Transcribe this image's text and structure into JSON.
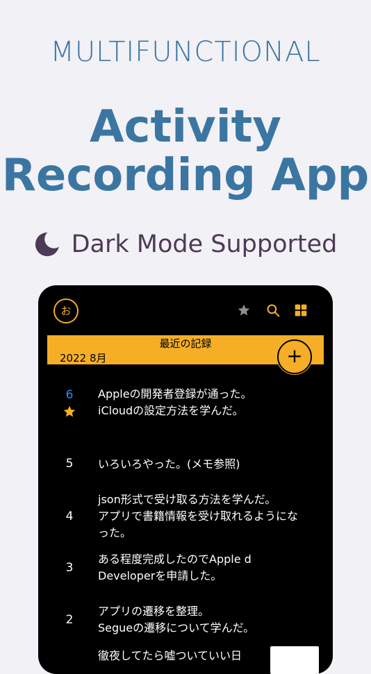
{
  "hero": {
    "subtitle": "MULTIFUNCTIONAL",
    "title_line1": "Activity",
    "title_line2": "Recording App",
    "dark_mode": "Dark Mode Supported"
  },
  "app": {
    "avatar_label": "お",
    "banner_title": "最近の記録",
    "month": "2022 8月",
    "add_label": "+",
    "accent_color": "#f5ae26",
    "today_color": "#2d8bf3",
    "entries": [
      {
        "day": "6",
        "text": "Appleの開発者登録が通った。\niCloudの設定方法を学んだ。",
        "favorite": true
      },
      {
        "day": "5",
        "text": "いろいろやった。(メモ参照)"
      },
      {
        "day": "4",
        "text": "json形式で受け取る方法を学んだ。\nアプリで書籍情報を受け取れるようにな\nった。"
      },
      {
        "day": "3",
        "text": "ある程度完成したのでApple d\nDeveloperを申請した。"
      },
      {
        "day": "2",
        "text": "アプリの遷移を整理。\nSegueの遷移について学んだ。"
      },
      {
        "day": "",
        "text": "徹夜してたら嘘ついていい日"
      }
    ]
  },
  "icons": [
    "moon-icon",
    "star-icon",
    "search-icon",
    "grid-icon",
    "plus-icon",
    "favorite-star-icon"
  ]
}
